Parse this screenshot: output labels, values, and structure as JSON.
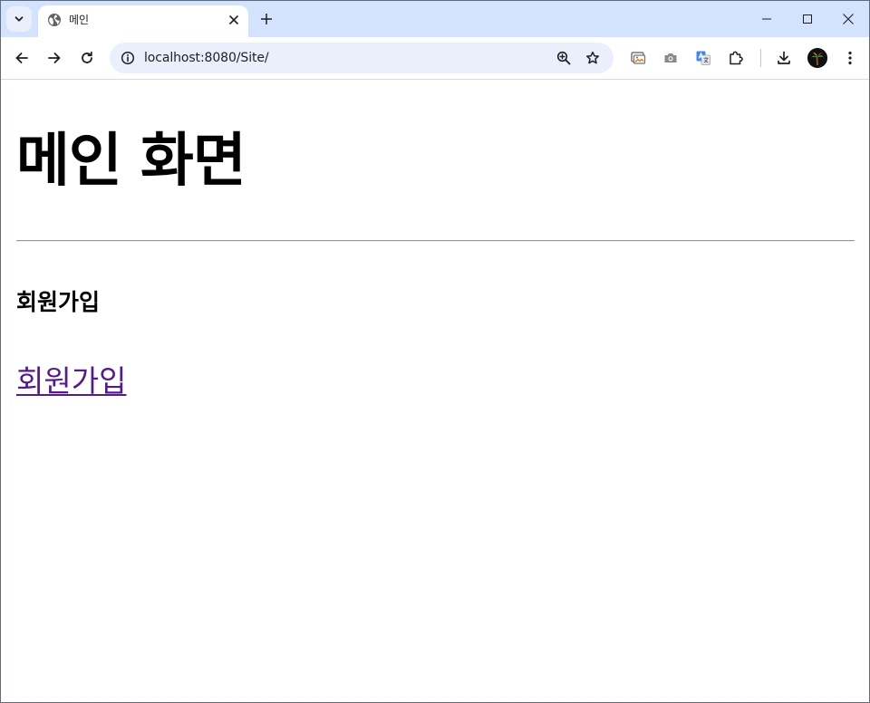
{
  "browser": {
    "tab": {
      "title": "메인",
      "favicon": "globe-icon"
    },
    "address_bar": {
      "url": "localhost:8080/Site/"
    },
    "icons": {
      "tab_search": "chevron-down-icon",
      "tab_close": "close-icon",
      "new_tab": "plus-icon",
      "minimize": "minimize-icon",
      "maximize": "maximize-icon",
      "close_window": "close-window-icon",
      "back": "back-arrow-icon",
      "forward": "forward-arrow-icon",
      "reload": "reload-icon",
      "site_info": "site-info-icon",
      "zoom": "zoom-in-icon",
      "bookmark": "star-icon",
      "ext_gallery": "gallery-extension-icon",
      "ext_screenshot": "camera-icon",
      "ext_translate": "translate-icon",
      "extensions": "puzzle-icon",
      "downloads": "download-icon",
      "profile": "avatar",
      "menu": "kebab-menu-icon"
    },
    "colors": {
      "tabstrip_bg": "#d3e3fd",
      "omnibox_bg": "#e9effb",
      "visited_link": "#551a8b"
    }
  },
  "page": {
    "title": "메인 화면",
    "section_heading": "회원가입",
    "signup_link": "회원가입"
  }
}
